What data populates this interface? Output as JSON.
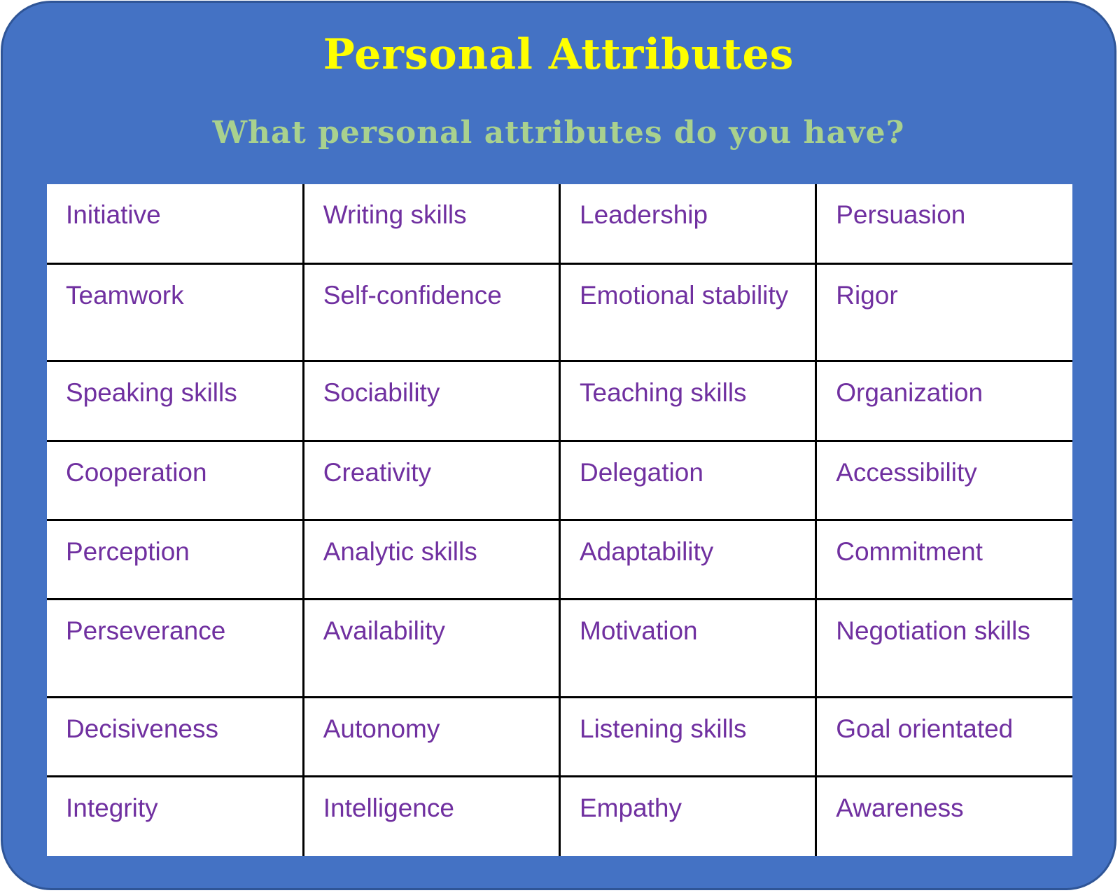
{
  "title": "Personal Attributes",
  "subtitle": "What personal attributes do you have?",
  "colors": {
    "panel_background": "#4472C4",
    "panel_border": "#2F5597",
    "title": "#FFFF00",
    "subtitle": "#A9D18E",
    "cell_text": "#7030A0",
    "table_background": "#FFFFFF",
    "grid_lines": "#000000"
  },
  "attributes_table": {
    "rows": [
      [
        "Initiative",
        "Writing skills",
        "Leadership",
        "Persuasion"
      ],
      [
        "Teamwork",
        "Self-confidence",
        "Emotional stability",
        "Rigor"
      ],
      [
        "Speaking skills",
        "Sociability",
        "Teaching skills",
        "Organization"
      ],
      [
        "Cooperation",
        "Creativity",
        "Delegation",
        "Accessibility"
      ],
      [
        "Perception",
        "Analytic skills",
        "Adaptability",
        "Commitment"
      ],
      [
        "Perseverance",
        "Availability",
        "Motivation",
        "Negotiation skills"
      ],
      [
        "Decisiveness",
        "Autonomy",
        "Listening skills",
        "Goal orientated"
      ],
      [
        "Integrity",
        "Intelligence",
        "Empathy",
        "Awareness"
      ]
    ]
  }
}
